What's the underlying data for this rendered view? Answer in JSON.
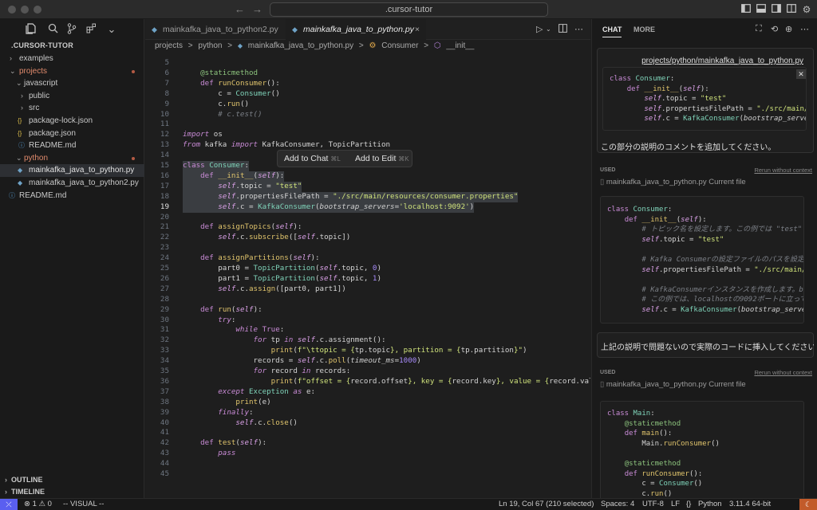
{
  "titlebar": {
    "search_text": ".cursor-tutor",
    "back": "←",
    "forward": "→"
  },
  "explorer": {
    "title": ".CURSOR-TUTOR",
    "items": [
      {
        "label": "examples",
        "type": "folder",
        "open": false,
        "depth": 0
      },
      {
        "label": "projects",
        "type": "folder",
        "open": true,
        "depth": 0,
        "modified": true
      },
      {
        "label": "javascript",
        "type": "folder",
        "open": true,
        "depth": 1
      },
      {
        "label": "public",
        "type": "folder",
        "open": false,
        "depth": 2
      },
      {
        "label": "src",
        "type": "folder",
        "open": false,
        "depth": 2
      },
      {
        "label": "package-lock.json",
        "type": "json",
        "depth": 2
      },
      {
        "label": "package.json",
        "type": "json",
        "depth": 2
      },
      {
        "label": "README.md",
        "type": "info",
        "depth": 2
      },
      {
        "label": "python",
        "type": "folder",
        "open": true,
        "depth": 1,
        "modified": true
      },
      {
        "label": "mainkafka_java_to_python.py",
        "type": "py",
        "depth": 2,
        "selected": true
      },
      {
        "label": "mainkafka_java_to_python2.py",
        "type": "py",
        "depth": 2
      },
      {
        "label": "README.md",
        "type": "info",
        "depth": 0
      }
    ],
    "outline": "OUTLINE",
    "timeline": "TIMELINE"
  },
  "editor": {
    "tabs": [
      {
        "label": "mainkafka_java_to_python2.py",
        "active": false
      },
      {
        "label": "mainkafka_java_to_python.py",
        "active": true
      }
    ],
    "breadcrumb": [
      "projects",
      ">",
      "python",
      ">",
      "mainkafka_java_to_python.py",
      ">",
      "Consumer",
      ">",
      "__init__"
    ],
    "popup": {
      "add_chat": "Add to Chat",
      "add_chat_sc": "⌘L",
      "add_edit": "Add to Edit",
      "add_edit_sc": "⌘K"
    }
  },
  "chat": {
    "tab_chat": "CHAT",
    "tab_more": "MORE",
    "user_msg_1": {
      "file_link": "projects/python/mainkafka_java_to_python.py",
      "text": "この部分の説明のコメントを追加してください。"
    },
    "used_label": "USED",
    "rerun_label": "Rerun without context",
    "file_context": "mainkafka_java_to_python.py Current file",
    "user_msg_2": "上記の説明で問題ないので実際のコードに挿入してください。"
  },
  "statusbar": {
    "errors": "⊗ 1 ⚠ 0",
    "mode": "-- VISUAL --",
    "position": "Ln 19, Col 67 (210 selected)",
    "spaces": "Spaces: 4",
    "encoding": "UTF-8",
    "eol": "LF",
    "braces": "{}",
    "language": "Python",
    "interpreter": "3.11.4 64-bit"
  }
}
